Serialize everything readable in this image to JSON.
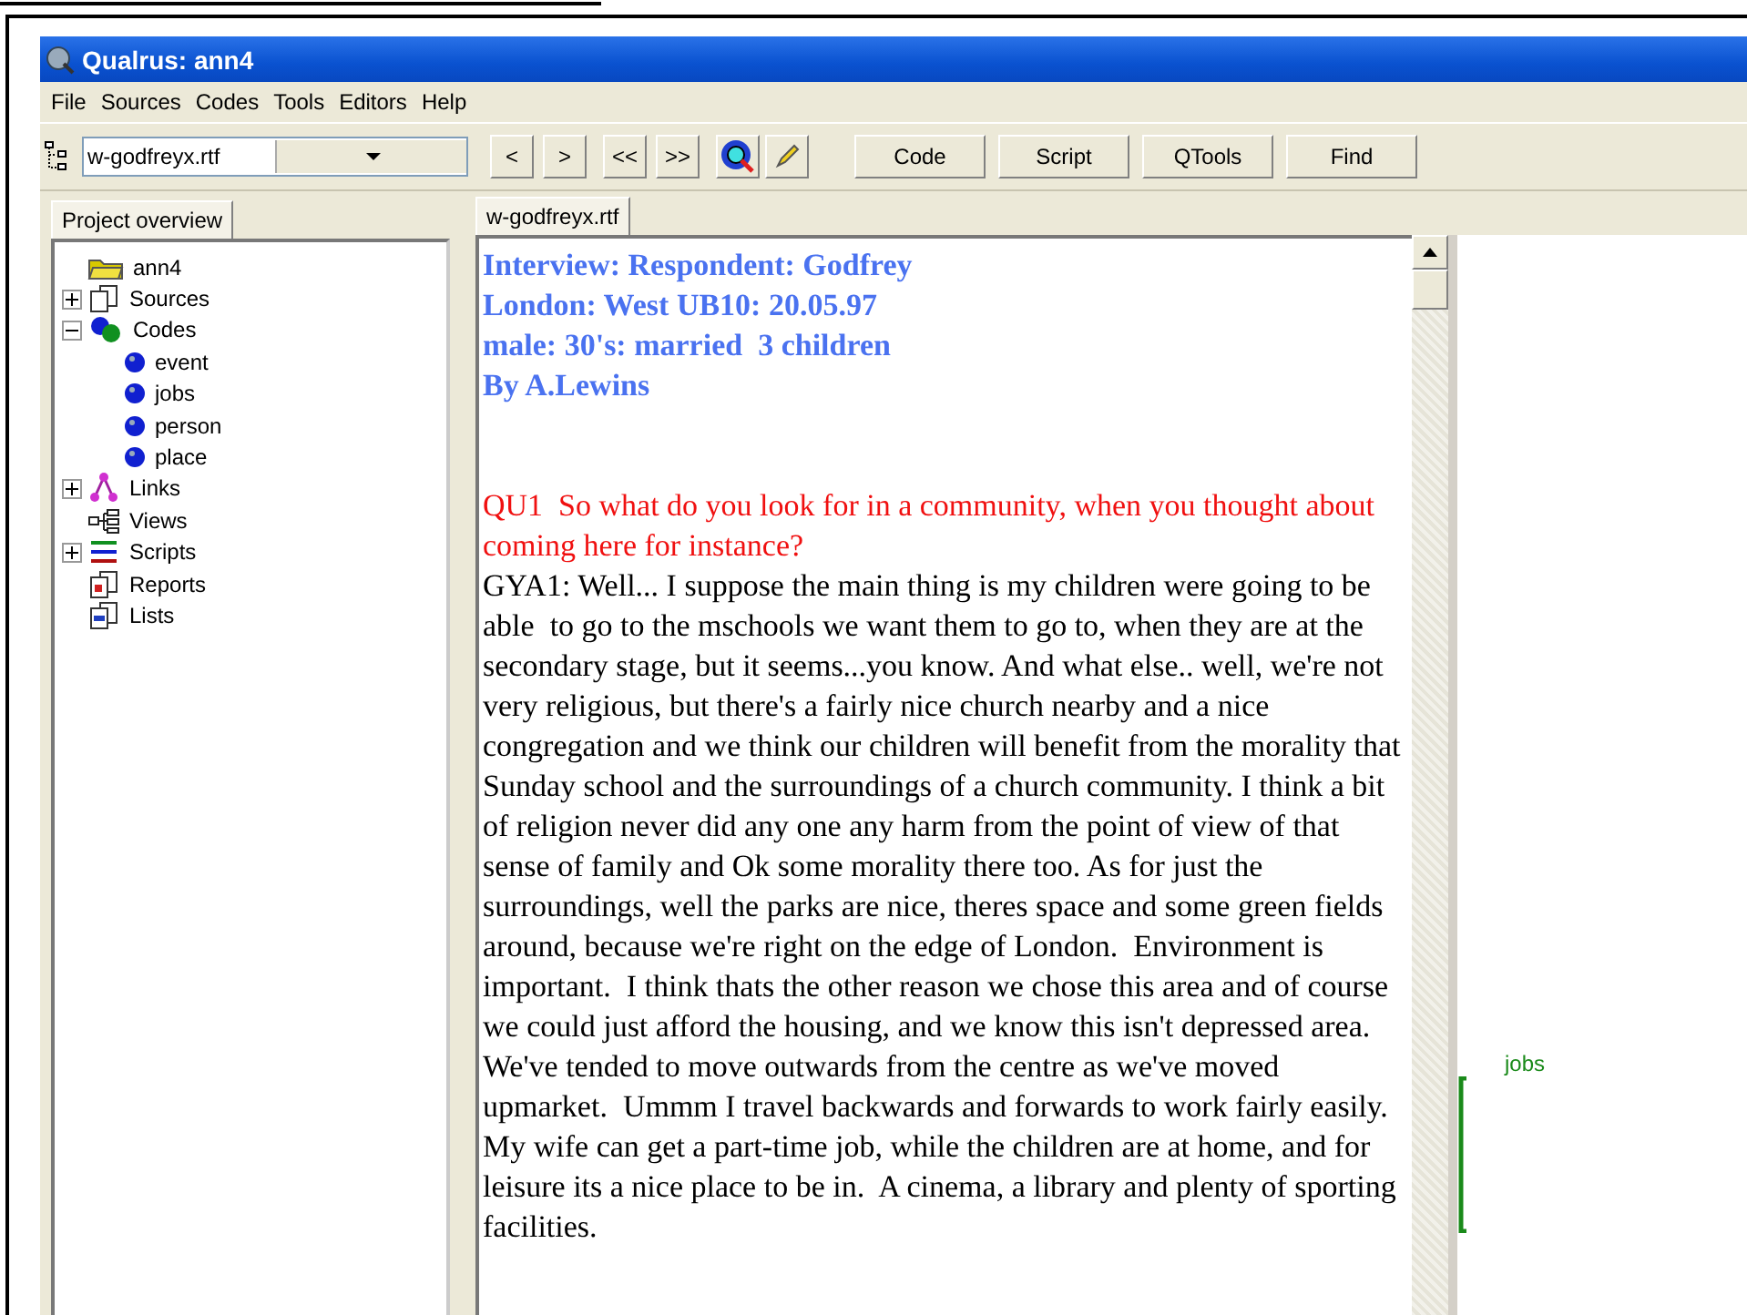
{
  "window": {
    "title": "Qualrus: ann4"
  },
  "menu": [
    "File",
    "Sources",
    "Codes",
    "Tools",
    "Editors",
    "Help"
  ],
  "toolbar": {
    "document_select": {
      "value": "w-godfreyx.rtf"
    },
    "nav_buttons": [
      "<",
      ">",
      "<<",
      ">>"
    ],
    "buttons": [
      "Code",
      "Script",
      "QTools",
      "Find"
    ]
  },
  "left_panel": {
    "tabs": [
      {
        "label": "Project overview",
        "selected": true
      }
    ],
    "tree": [
      {
        "label": "ann4",
        "kind": "project",
        "children": [
          {
            "label": "Sources",
            "kind": "sources",
            "expanded": false
          },
          {
            "label": "Codes",
            "kind": "codes",
            "expanded": true,
            "children": [
              {
                "label": "event",
                "kind": "code"
              },
              {
                "label": "jobs",
                "kind": "code"
              },
              {
                "label": "person",
                "kind": "code"
              },
              {
                "label": "place",
                "kind": "code"
              }
            ]
          },
          {
            "label": "Links",
            "kind": "links",
            "expanded": false
          },
          {
            "label": "Views",
            "kind": "views"
          },
          {
            "label": "Scripts",
            "kind": "scripts",
            "expanded": false
          },
          {
            "label": "Reports",
            "kind": "reports"
          },
          {
            "label": "Lists",
            "kind": "lists"
          }
        ]
      }
    ]
  },
  "document": {
    "tabs": [
      {
        "label": "w-godfreyx.rtf",
        "selected": true
      }
    ],
    "header_lines": [
      "Interview: Respondent: Godfrey",
      "London: West UB10: 20.05.97",
      "male: 30's: married  3 children",
      "By A.Lewins"
    ],
    "question": "QU1  So what do you look for in a community, when you thought about coming here for instance?",
    "answer": "GYA1: Well... I suppose the main thing is my children were going to be able  to go to the mschools we want them to go to, when they are at the secondary stage, but it seems...you know. And what else.. well, we're not very religious, but there's a fairly nice church nearby and a nice congregation and we think our children will benefit from the morality that Sunday school and the surroundings of a church community. I think a bit of religion never did any one any harm from the point of view of that sense of family and Ok some morality there too. As for just the surroundings, well the parks are nice, theres space and some green fields around, because we're right on the edge of London.  Environment is important.  I think thats the other reason we chose this area and of course we could just afford the housing, and we know this isn't depressed area. We've tended to move outwards from the centre as we've moved upmarket.  Ummm I travel backwards and forwards to work fairly easily. My wife can get a part-time job, while the children are at home, and for leisure its a nice place to be in.  A cinema, a library and plenty of sporting facilities.",
    "code_marks": [
      {
        "label": "jobs",
        "color": "#1a8a1a"
      }
    ]
  }
}
